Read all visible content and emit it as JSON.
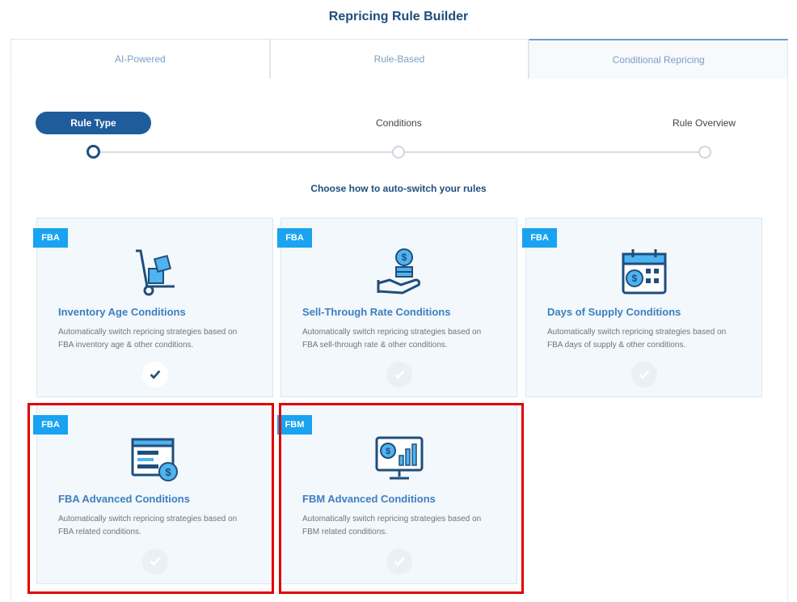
{
  "page": {
    "title": "Repricing Rule Builder",
    "subtitle": "Choose how to auto-switch your rules"
  },
  "tabs": [
    {
      "label": "AI-Powered",
      "active": false
    },
    {
      "label": "Rule-Based",
      "active": false
    },
    {
      "label": "Conditional Repricing",
      "active": true
    }
  ],
  "steps": [
    {
      "label": "Rule Type",
      "active": true
    },
    {
      "label": "Conditions",
      "active": false
    },
    {
      "label": "Rule Overview",
      "active": false
    }
  ],
  "cards": [
    {
      "badge": "FBA",
      "icon": "hand-truck-boxes-icon",
      "title": "Inventory Age Conditions",
      "desc_line1": "Automatically switch repricing strategies based on",
      "desc_line2": "FBA inventory age & other conditions.",
      "selected": true
    },
    {
      "badge": "FBA",
      "icon": "hand-coins-icon",
      "title": "Sell-Through Rate Conditions",
      "desc_line1": "Automatically switch repricing strategies based on",
      "desc_line2": "FBA sell-through rate & other conditions.",
      "selected": false
    },
    {
      "badge": "FBA",
      "icon": "calendar-dollar-icon",
      "title": "Days of Supply Conditions",
      "desc_line1": "Automatically switch repricing strategies based on",
      "desc_line2": "FBA days of supply & other conditions.",
      "selected": false
    },
    {
      "badge": "FBA",
      "icon": "document-dollar-icon",
      "title": "FBA Advanced Conditions",
      "desc_line1": "Automatically switch repricing strategies based on",
      "desc_line2": "FBA related conditions.",
      "selected": false
    },
    {
      "badge": "FBM",
      "icon": "monitor-chart-dollar-icon",
      "title": "FBM Advanced Conditions",
      "desc_line1": "Automatically switch repricing strategies based on",
      "desc_line2": "FBM related conditions.",
      "selected": false
    }
  ],
  "colors": {
    "accent": "#1f5c9c",
    "badge": "#1aa3f0",
    "card_title": "#3d7fbf",
    "highlight": "#e00000"
  }
}
